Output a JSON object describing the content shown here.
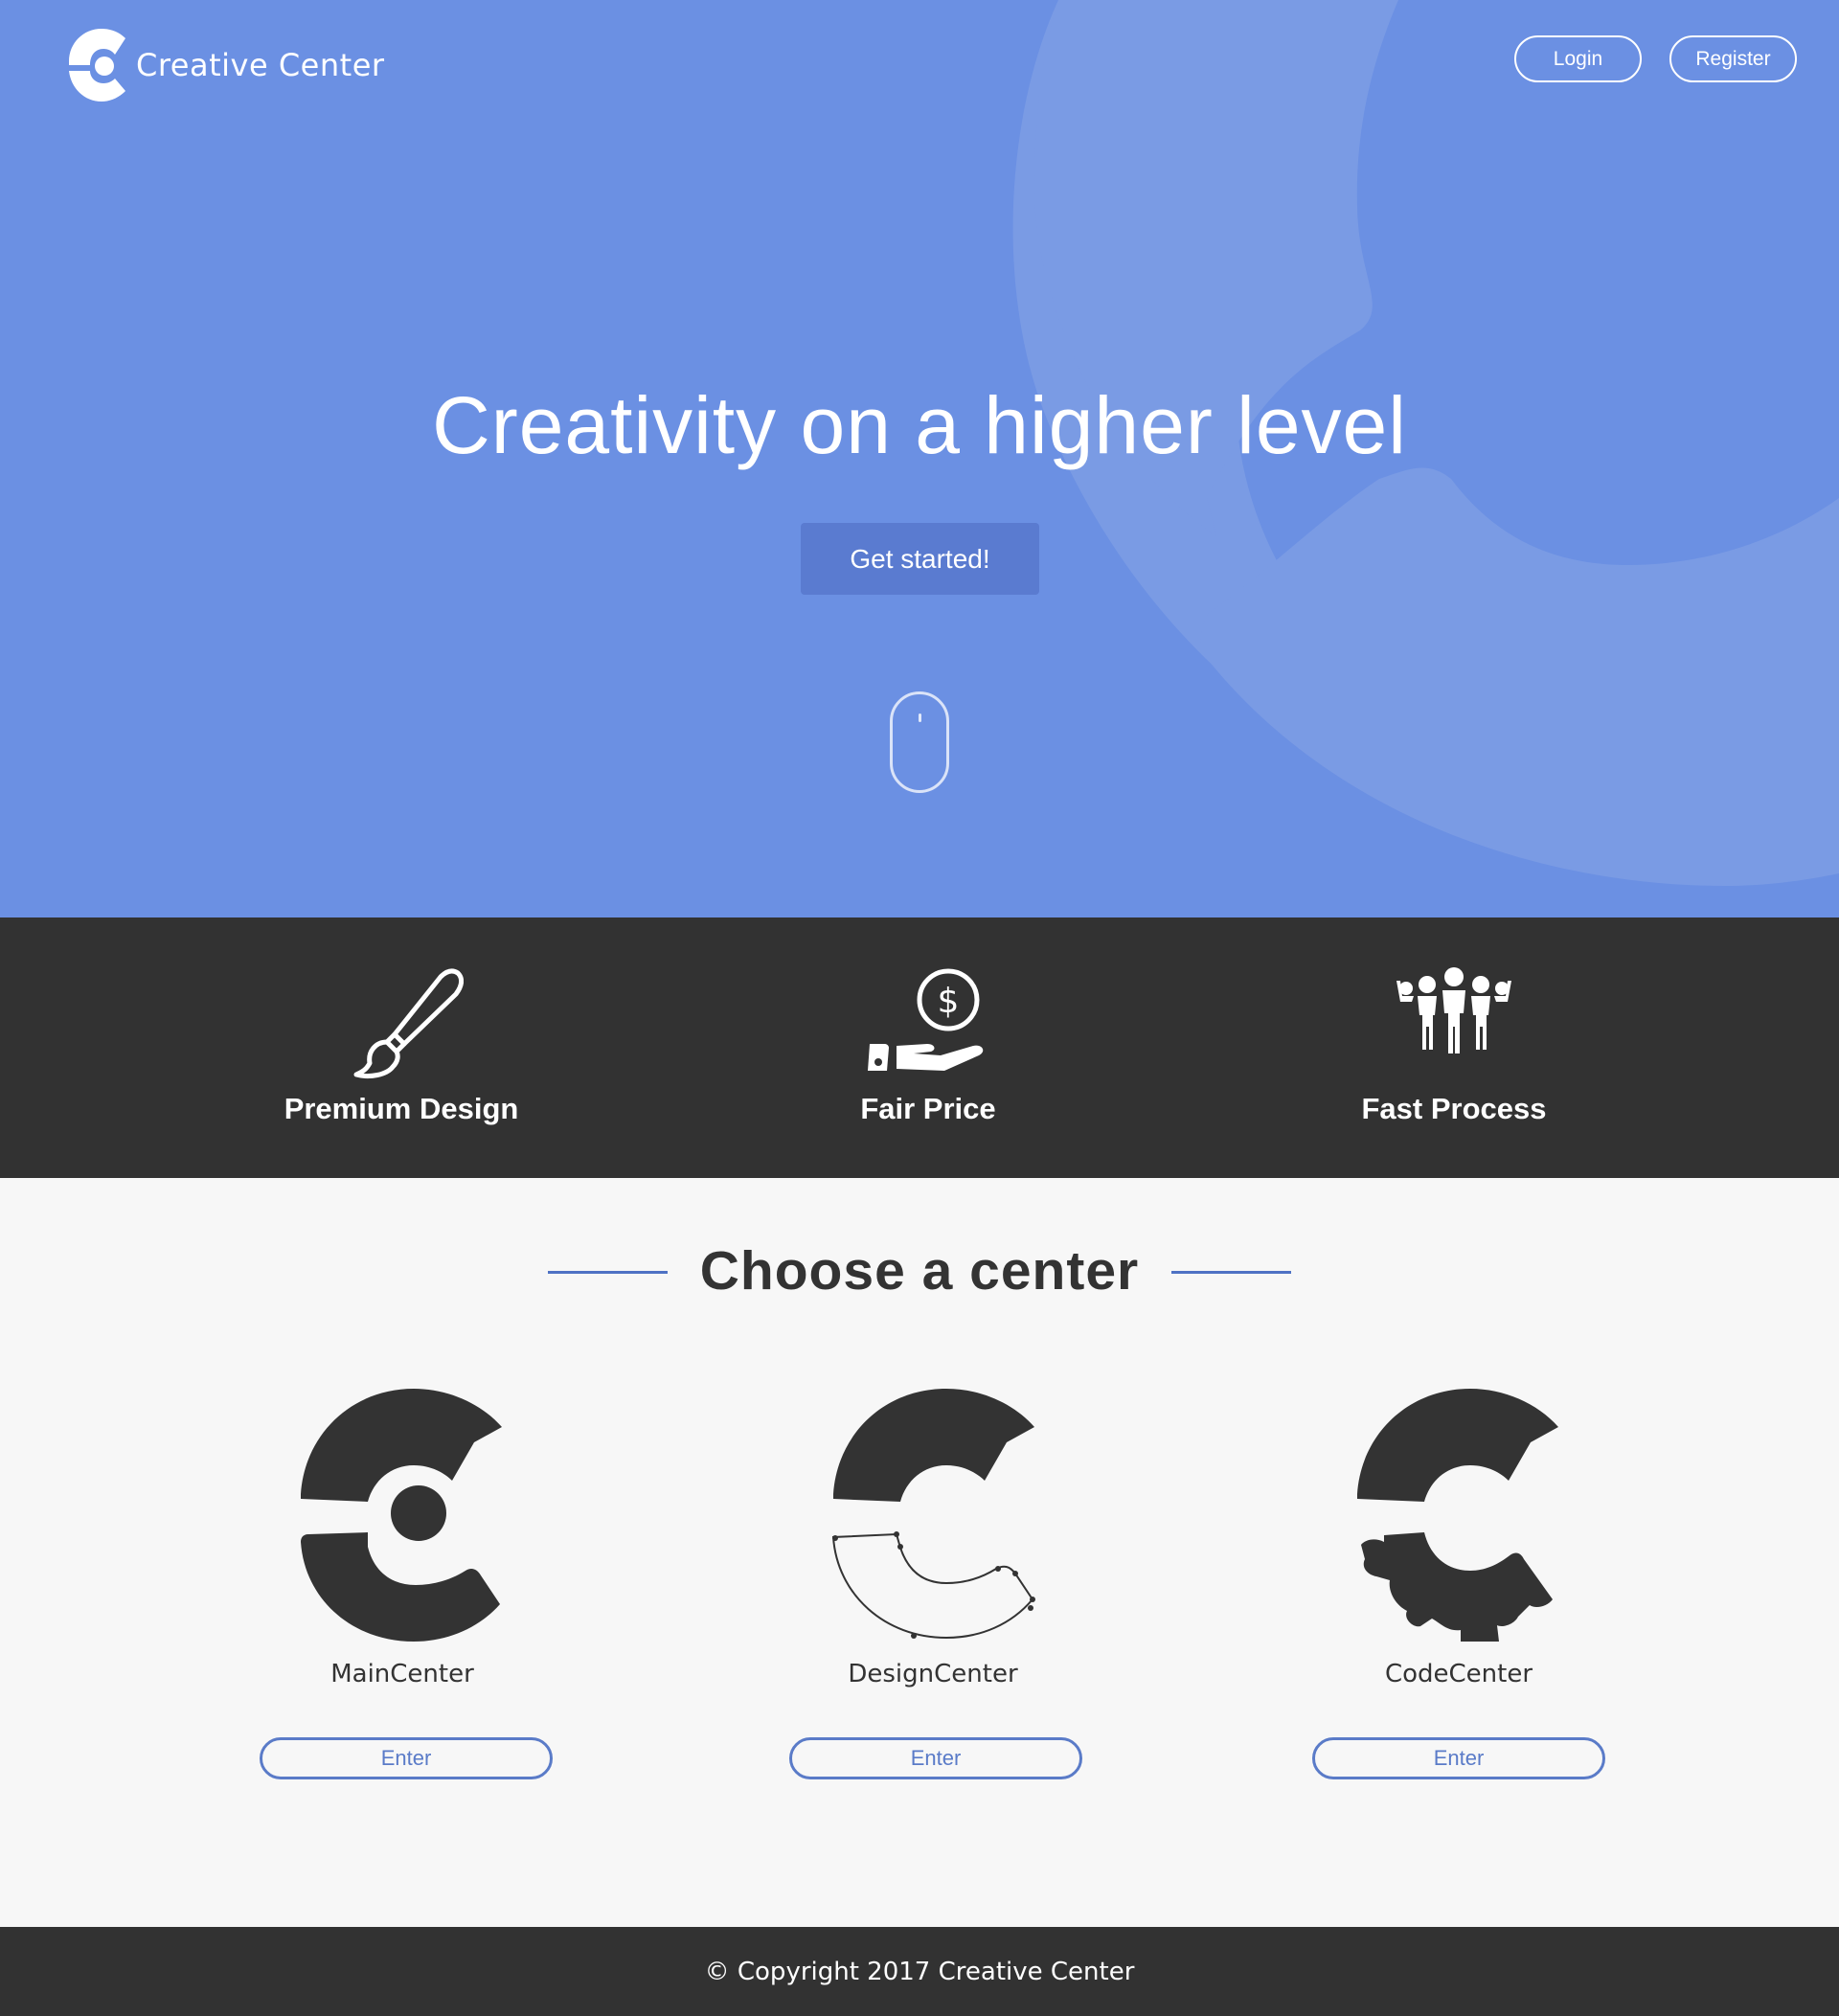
{
  "brand": {
    "name": "Creative Center"
  },
  "nav": {
    "login_label": "Login",
    "register_label": "Register"
  },
  "hero": {
    "title": "Creativity on a higher level",
    "cta_label": "Get started!"
  },
  "features": [
    {
      "label": "Premium Design",
      "icon": "paintbrush-icon"
    },
    {
      "label": "Fair Price",
      "icon": "hand-coin-icon"
    },
    {
      "label": "Fast Process",
      "icon": "team-icon"
    }
  ],
  "centers": {
    "title": "Choose a center",
    "items": [
      {
        "name": "MainCenter",
        "button_label": "Enter"
      },
      {
        "name": "DesignCenter",
        "button_label": "Enter"
      },
      {
        "name": "CodeCenter",
        "button_label": "Enter"
      }
    ]
  },
  "footer": {
    "copyright": "© Copyright 2017 Creative Center"
  },
  "colors": {
    "hero_bg": "#6b90e3",
    "accent": "#5a7bc8",
    "dark": "#323232"
  }
}
